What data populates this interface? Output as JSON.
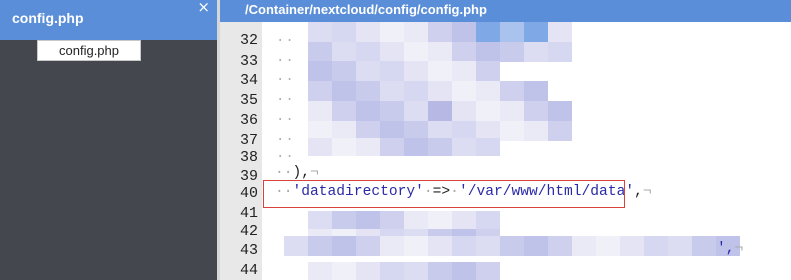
{
  "left_panel": {
    "title": "config.php",
    "file_tab": "config.php"
  },
  "editor": {
    "path": "/Container/nextcloud/config/config.php",
    "line_numbers": [
      "32",
      "33",
      "34",
      "35",
      "36",
      "37",
      "38",
      "39",
      "40",
      "41",
      "42",
      "43",
      "44"
    ],
    "closing": "),",
    "key": "'datadirectory'",
    "arrow": "=>",
    "value": "'/var/www/html/data'",
    "comma": ",",
    "end_line_43": "',",
    "pilcrow": "¬"
  }
}
